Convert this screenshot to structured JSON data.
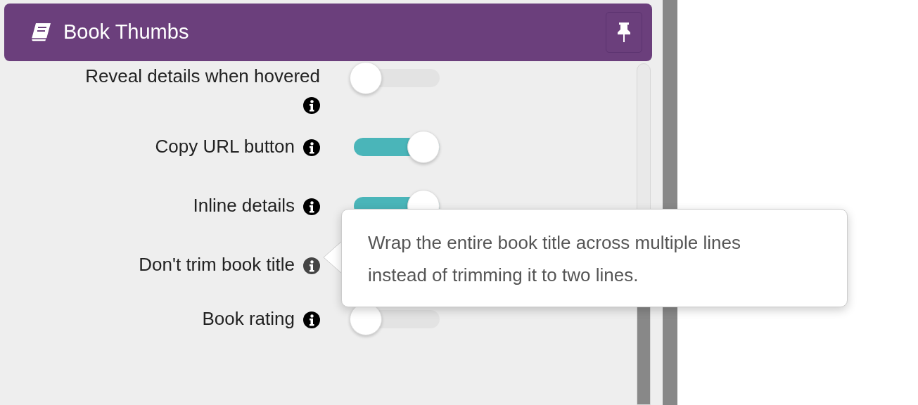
{
  "panel": {
    "title": "Book Thumbs",
    "settings": [
      {
        "label": "Reveal details when hovered",
        "on": false,
        "info_active": false
      },
      {
        "label": "Copy URL button",
        "on": true,
        "info_active": false
      },
      {
        "label": "Inline details",
        "on": true,
        "info_active": false
      },
      {
        "label": "Don't trim book title",
        "info_active": true
      },
      {
        "label": "Book rating",
        "on": false,
        "info_active": false
      }
    ]
  },
  "tooltip": {
    "text": "Wrap the entire book title across multiple lines instead of trimming it to two lines."
  }
}
